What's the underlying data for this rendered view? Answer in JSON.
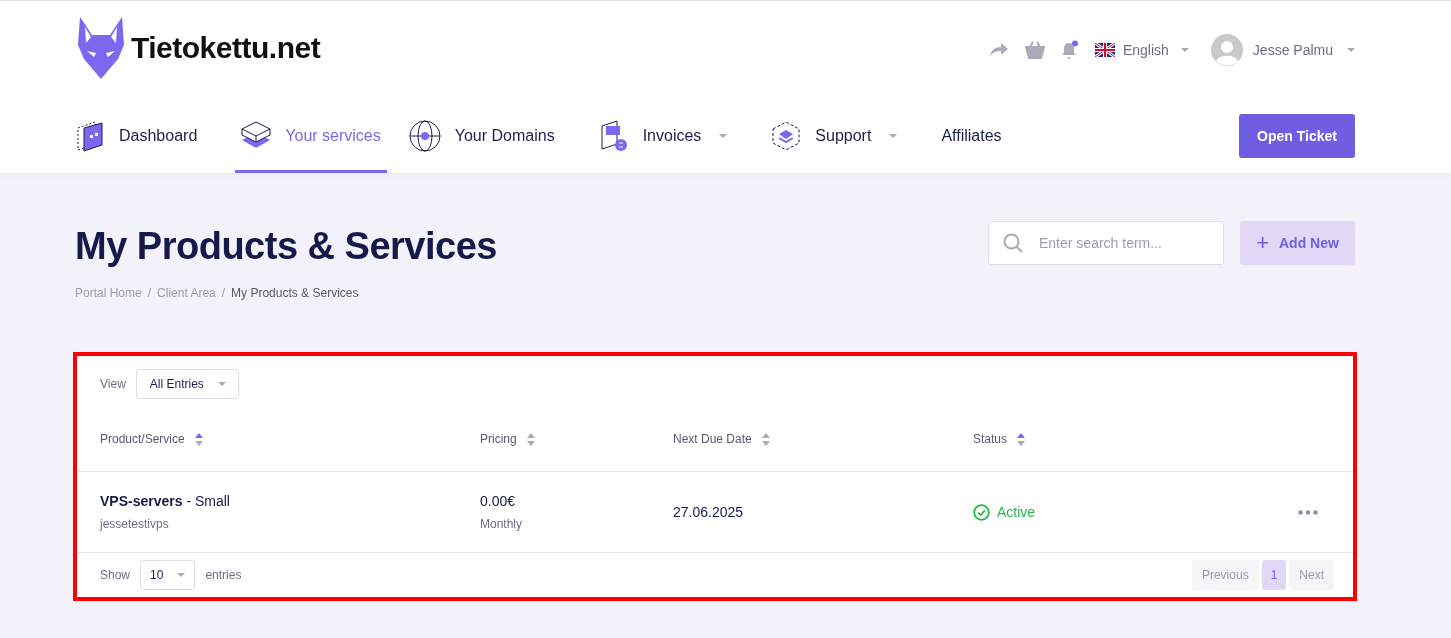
{
  "brand": {
    "name": "Tietokettu.net"
  },
  "topbar": {
    "notification_dot": true,
    "language": "English",
    "user": "Jesse Palmu"
  },
  "nav": [
    {
      "label": "Dashboard",
      "kind": "dashboard",
      "selected": false,
      "dropdown": false
    },
    {
      "label": "Your services",
      "kind": "services",
      "selected": true,
      "dropdown": false
    },
    {
      "label": "Your Domains",
      "kind": "domains",
      "selected": false,
      "dropdown": false
    },
    {
      "label": "Invoices",
      "kind": "invoices",
      "selected": false,
      "dropdown": true
    },
    {
      "label": "Support",
      "kind": "support",
      "selected": false,
      "dropdown": true
    },
    {
      "label": "Affiliates",
      "kind": "none",
      "selected": false,
      "dropdown": false
    }
  ],
  "open_ticket": "Open Ticket",
  "page": {
    "title": "My Products & Services",
    "breadcrumb_separator": "/",
    "breadcrumb": [
      {
        "label": "Portal Home",
        "current": false
      },
      {
        "label": "Client Area",
        "current": false
      },
      {
        "label": "My Products & Services",
        "current": true
      }
    ]
  },
  "search": {
    "placeholder": "Enter search term..."
  },
  "add_button": {
    "icon": "+",
    "label": "Add New"
  },
  "table": {
    "view_label": "View",
    "view_value": "All Entries",
    "columns": [
      {
        "label": "Product/Service",
        "sorted": true
      },
      {
        "label": "Pricing",
        "sorted": false
      },
      {
        "label": "Next Due Date",
        "sorted": false
      },
      {
        "label": "Status",
        "sorted": true
      }
    ],
    "rows": [
      {
        "product": "**VPS-servers** - Small",
        "domain": "jessetestivps",
        "price": "0.00€",
        "cycle": "Monthly",
        "due": "27.06.2025",
        "status": "Active",
        "kind": "active"
      }
    ],
    "show_label": "Show",
    "page_size": "10",
    "entries_label": "entries",
    "pagination": [
      {
        "label": "Previous",
        "kind": "prev",
        "disabled": true,
        "selected": false
      },
      {
        "label": "1",
        "kind": "page",
        "disabled": false,
        "selected": true
      },
      {
        "label": "Next",
        "kind": "next",
        "disabled": true,
        "selected": false
      }
    ]
  }
}
